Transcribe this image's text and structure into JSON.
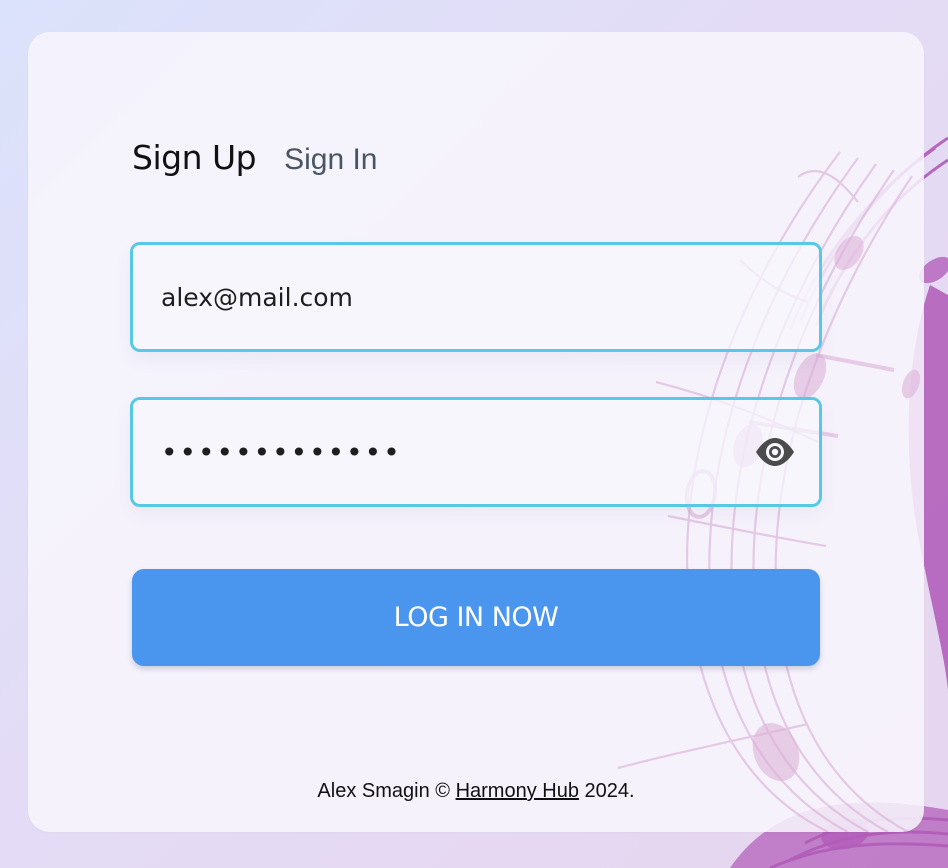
{
  "tabs": {
    "sign_up": "Sign Up",
    "sign_in": "Sign In"
  },
  "email_field": {
    "value": "alex@mail.com"
  },
  "password_field": {
    "value": "•••••••••••••"
  },
  "login_button": {
    "label": "LOG IN NOW"
  },
  "footer": {
    "author": "Alex Smagin ©",
    "brand_link": "Harmony Hub",
    "year": "2024."
  },
  "icons": {
    "password_visibility": "eye-icon"
  },
  "colors": {
    "field_border": "#57c8e5",
    "button": "#4a95ed",
    "background_accent": "#b871bf"
  }
}
